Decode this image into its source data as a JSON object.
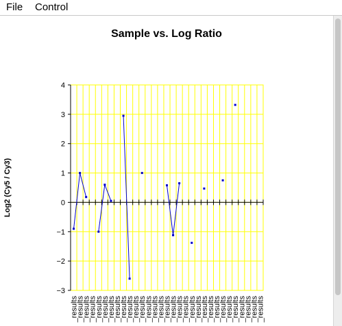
{
  "menu": {
    "file_label": "File",
    "control_label": "Control"
  },
  "colors": {
    "grid": "#ffff00",
    "series": "#0000cc",
    "axis": "#000000",
    "window_bg": "#ffffff"
  },
  "chart_data": {
    "type": "line",
    "title": "Sample vs. Log Ratio",
    "ylabel": "Log2 (Cy5 / Cy3)",
    "xlabel": "",
    "ylim": [
      -3,
      4
    ],
    "yticks": [
      4,
      3,
      2,
      1,
      0,
      -1,
      -2,
      -3
    ],
    "grid": true,
    "x_tick_label": "_results",
    "num_samples": 31,
    "series": [
      {
        "values": [
          -0.9,
          1.0,
          0.18,
          null,
          -1.0,
          0.6,
          0.05,
          null,
          2.95,
          -2.6,
          null,
          1.0,
          null,
          null,
          null,
          0.58,
          -1.12,
          0.65,
          null,
          -1.38,
          null,
          0.47,
          null,
          null,
          0.75,
          null,
          3.32,
          null,
          null,
          null,
          null
        ]
      }
    ]
  }
}
